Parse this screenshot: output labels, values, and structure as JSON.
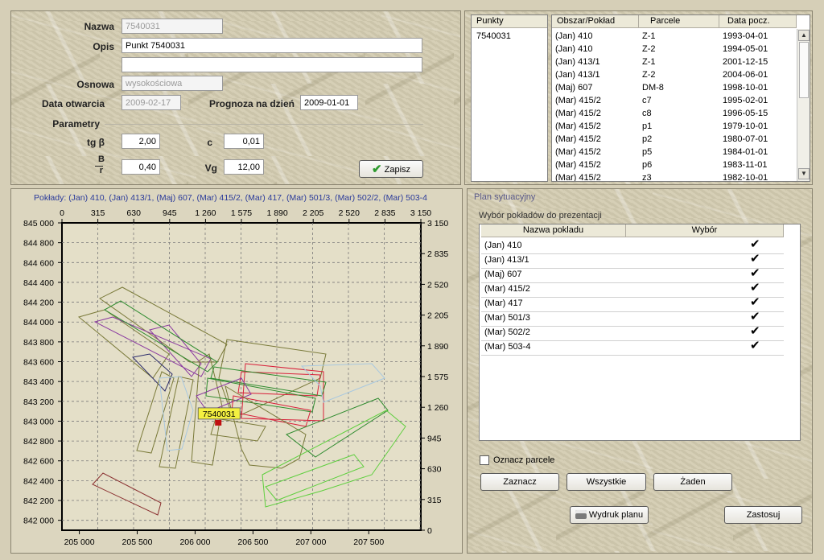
{
  "form": {
    "nazwa_label": "Nazwa",
    "nazwa_value": "7540031",
    "opis_label": "Opis",
    "opis_value": "Punkt 7540031",
    "opis_value2": "",
    "osnowa_label": "Osnowa",
    "osnowa_value": "wysokościowa",
    "data_otwarcia_label": "Data otwarcia",
    "data_otwarcia_value": "2009-02-17",
    "prognoza_label": "Prognoza na dzień",
    "prognoza_value": "2009-01-01",
    "parametry_label": "Parametry",
    "tgb_label": "tg β",
    "tgb_value": "2,00",
    "c_label": "c",
    "c_value": "0,01",
    "br_label_top": "B",
    "br_label_bottom": "r",
    "br_value": "0,40",
    "vg_label": "Vg",
    "vg_value": "12,00",
    "zapisz_label": "Zapisz"
  },
  "punkty": {
    "header": "Punkty",
    "items": [
      "7540031"
    ]
  },
  "obszar_table": {
    "headers": [
      "Obszar/Pokład",
      "Parcele",
      "Data pocz."
    ],
    "rows": [
      [
        "(Jan) 410",
        "Z-1",
        "1993-04-01"
      ],
      [
        "(Jan) 410",
        "Z-2",
        "1994-05-01"
      ],
      [
        "(Jan) 413/1",
        "Z-1",
        "2001-12-15"
      ],
      [
        "(Jan) 413/1",
        "Z-2",
        "2004-06-01"
      ],
      [
        "(Maj) 607",
        "DM-8",
        "1998-10-01"
      ],
      [
        "(Mar) 415/2",
        "c7",
        "1995-02-01"
      ],
      [
        "(Mar) 415/2",
        "c8",
        "1996-05-15"
      ],
      [
        "(Mar) 415/2",
        "p1",
        "1979-10-01"
      ],
      [
        "(Mar) 415/2",
        "p2",
        "1980-07-01"
      ],
      [
        "(Mar) 415/2",
        "p5",
        "1984-01-01"
      ],
      [
        "(Mar) 415/2",
        "p6",
        "1983-11-01"
      ],
      [
        "(Mar) 415/2",
        "z3",
        "1982-10-01"
      ]
    ]
  },
  "chart": {
    "caption": "Pokłady:  (Jan) 410, (Jan) 413/1, (Maj) 607, (Mar) 415/2, (Mar) 417, (Mar) 501/3, (Mar) 502/2, (Mar) 503-4",
    "marker_label": "7540031"
  },
  "chart_data": {
    "type": "map",
    "left_ticks": [
      "845 000",
      "844 800",
      "844 600",
      "844 400",
      "844 200",
      "844 000",
      "843 800",
      "843 600",
      "843 400",
      "843 200",
      "843 000",
      "842 800",
      "842 600",
      "842 400",
      "842 200",
      "842 000"
    ],
    "bottom_ticks": [
      "205 000",
      "205 500",
      "206 000",
      "206 500",
      "207 000",
      "207 500"
    ],
    "top_ticks": [
      "0",
      "315",
      "630",
      "945",
      "1 260",
      "1 575",
      "1 890",
      "2 205",
      "2 520",
      "2 835",
      "3 150"
    ],
    "right_ticks": [
      "3 150",
      "2 835",
      "2 520",
      "2 205",
      "1 890",
      "1 575",
      "1 260",
      "945",
      "630",
      "315",
      "0"
    ],
    "x_range": [
      204850,
      207950
    ],
    "y_range": [
      841900,
      845000
    ],
    "marker": {
      "x": 206200,
      "y": 842980
    },
    "colors": {
      "olive": "#7a7a3a",
      "green": "#2e8b2e",
      "lightgreen": "#5fcf3f",
      "red": "#d8203a",
      "purple": "#8a3aa0",
      "navy": "#2a2a6a",
      "lightblue": "#a8c8e0",
      "brown": "#8a3030"
    },
    "grid": true
  },
  "plan": {
    "title": "Plan sytuacyjny",
    "subtitle": "Wybór pokładów do prezentacji",
    "headers": [
      "Nazwa pokladu",
      "Wybór"
    ],
    "rows": [
      {
        "name": "(Jan) 410",
        "checked": true
      },
      {
        "name": "(Jan) 413/1",
        "checked": true
      },
      {
        "name": "(Maj) 607",
        "checked": true
      },
      {
        "name": "(Mar) 415/2",
        "checked": true
      },
      {
        "name": "(Mar) 417",
        "checked": true
      },
      {
        "name": "(Mar) 501/3",
        "checked": true
      },
      {
        "name": "(Mar) 502/2",
        "checked": true
      },
      {
        "name": "(Mar) 503-4",
        "checked": true
      }
    ],
    "checkmark": "✔",
    "oznacz_label": "Oznacz parcele",
    "zaznacz_label": "Zaznacz",
    "wszystkie_label": "Wszystkie",
    "zaden_label": "Żaden",
    "wydruk_label": "Wydruk planu",
    "zastosuj_label": "Zastosuj"
  }
}
